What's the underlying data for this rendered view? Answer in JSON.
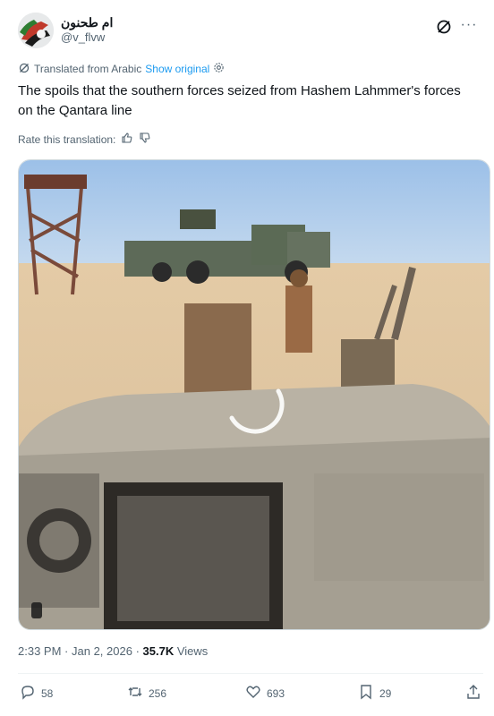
{
  "author": {
    "display_name": "ام طحنون",
    "handle": "@v_flvw"
  },
  "translation": {
    "label": "Translated from Arabic",
    "show_original": "Show original",
    "rate_label": "Rate this translation:"
  },
  "tweet": {
    "text": "The spoils that the southern forces seized from Hashem Lahmmer's forces on the Qantara line",
    "time": "2:33 PM",
    "date": "Jan 2, 2026",
    "views_count": "35.7K",
    "views_label": "Views"
  },
  "actions": {
    "replies": "58",
    "reposts": "256",
    "likes": "693",
    "bookmarks": "29"
  },
  "colors": {
    "link": "#1d9bf0",
    "muted": "#536471"
  }
}
